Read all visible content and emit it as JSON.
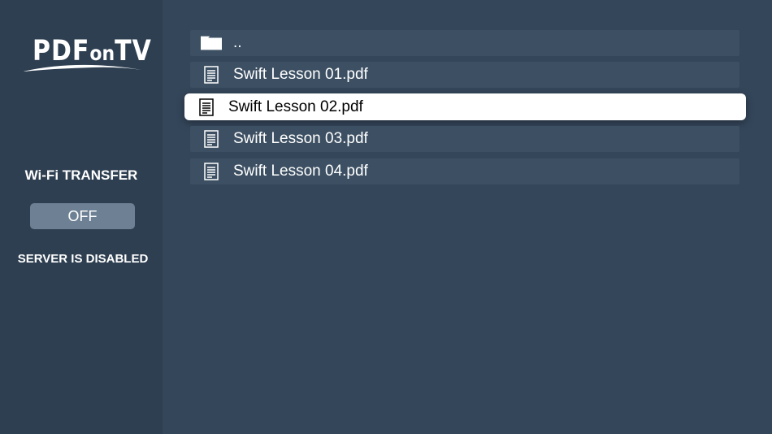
{
  "sidebar": {
    "logo": {
      "text_main": "PDF",
      "text_small": "on",
      "text_end": "TV"
    },
    "wifi_title": "Wi-Fi TRANSFER",
    "toggle_label": "OFF",
    "server_status": "SERVER IS DISABLED"
  },
  "files": [
    {
      "label": "..",
      "icon": "folder-icon"
    },
    {
      "label": "Swift Lesson 01.pdf",
      "icon": "document-icon"
    },
    {
      "label": "Swift Lesson 02.pdf",
      "icon": "document-icon",
      "selected": true
    },
    {
      "label": "Swift Lesson 03.pdf",
      "icon": "document-icon"
    },
    {
      "label": "Swift Lesson 04.pdf",
      "icon": "document-icon"
    }
  ],
  "colors": {
    "background": "#34465a",
    "sidebar": "#2e3f51",
    "row": "#3d5063",
    "selected_row": "#ffffff",
    "toggle": "#6e8093"
  }
}
